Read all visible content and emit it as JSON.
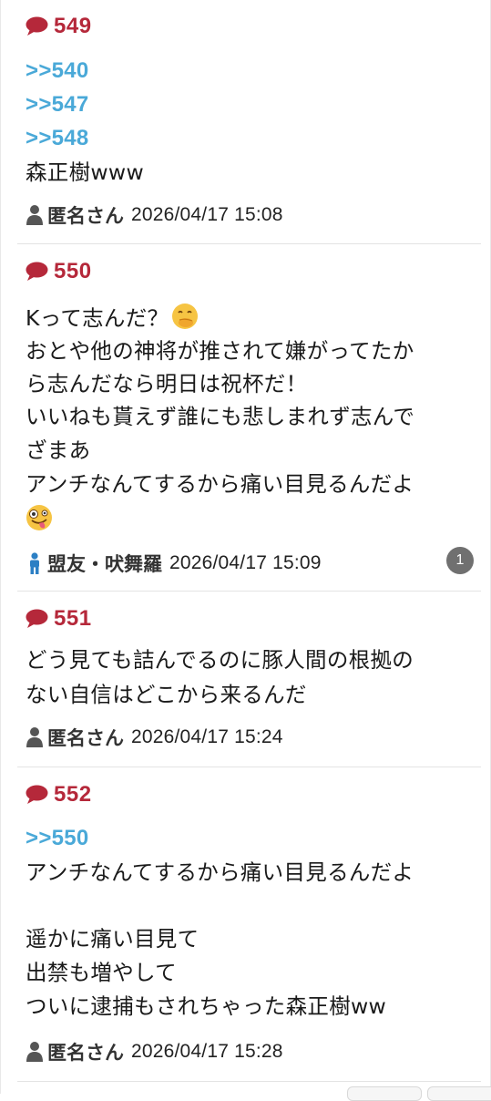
{
  "posts": [
    {
      "number": "549",
      "anchors": [
        ">>540",
        ">>547",
        ">>548"
      ],
      "body": [
        "森正樹www"
      ],
      "author": "匿名さん",
      "date": "2026/04/17 15:08",
      "author_icon": "person-gray-icon"
    },
    {
      "number": "550",
      "anchors": [],
      "body": [
        "Kって志んだ？",
        "おとや他の神将が推されて嫌がってたか",
        "ら志んだなら明日は祝杯だ！",
        "いいねも貰えず誰にも悲しまれず志んで",
        "ざまあ",
        "アンチなんてするから痛い目見るんだよ"
      ],
      "emojis": [
        "face-with-hand-over-mouth-emoji",
        "zany-face-emoji"
      ],
      "author": "盟友・吠舞羅",
      "date": "2026/04/17 15:09",
      "author_icon": "person-blue-icon",
      "reply_count": "1"
    },
    {
      "number": "551",
      "anchors": [],
      "body": [
        "どう見ても詰んでるのに豚人間の根拠の",
        "ない自信はどこから来るんだ"
      ],
      "author": "匿名さん",
      "date": "2026/04/17 15:24",
      "author_icon": "person-gray-icon"
    },
    {
      "number": "552",
      "anchors": [
        ">>550"
      ],
      "body": [
        "アンチなんてするから痛い目見るんだよ",
        "",
        "遥かに痛い目見て",
        "出禁も増やして",
        "ついに逮捕もされちゃった森正樹ww"
      ],
      "author": "匿名さん",
      "date": "2026/04/17 15:28",
      "author_icon": "person-gray-icon"
    }
  ],
  "colors": {
    "number": "#b5283a",
    "anchor": "#4aa9d8",
    "person_gray": "#555555",
    "person_blue": "#2c7fc4",
    "badge": "#707070"
  }
}
